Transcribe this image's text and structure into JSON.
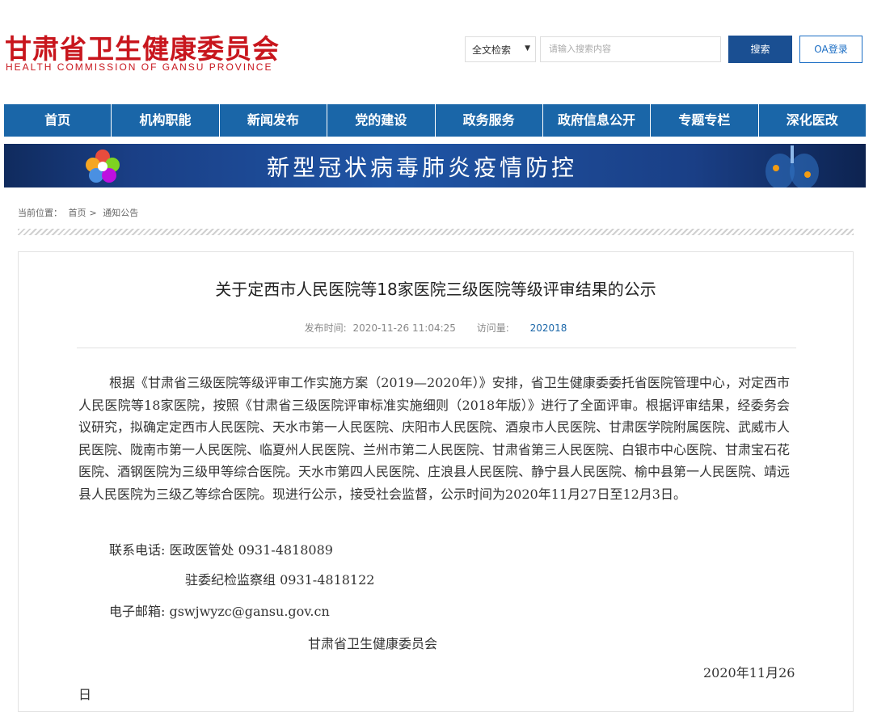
{
  "header": {
    "logo_cn": "甘肃省卫生健康委员会",
    "logo_en": "HEALTH COMMISSION OF GANSU PROVINCE",
    "search": {
      "scope": "全文检索",
      "placeholder": "请输入搜索内容",
      "button": "搜索"
    },
    "oa_button": "OA登录"
  },
  "nav": [
    "首页",
    "机构职能",
    "新闻发布",
    "党的建设",
    "政务服务",
    "政府信息公开",
    "专题专栏",
    "深化医改"
  ],
  "banner": {
    "text": "新型冠状病毒肺炎疫情防控"
  },
  "breadcrumb": {
    "label": "当前位置：",
    "home": "首页",
    "sep": ">",
    "current": "通知公告"
  },
  "article": {
    "title": "关于定西市人民医院等18家医院三级医院等级评审结果的公示",
    "publish_label": "发布时间:",
    "publish_time": "2020-11-26 11:04:25",
    "views_label": "访问量:",
    "views": "202018",
    "body": "根据《甘肃省三级医院等级评审工作实施方案（2019—2020年）》安排，省卫生健康委委托省医院管理中心，对定西市人民医院等18家医院，按照《甘肃省三级医院评审标准实施细则（2018年版）》进行了全面评审。根据评审结果，经委务会议研究，拟确定定西市人民医院、天水市第一人民医院、庆阳市人民医院、酒泉市人民医院、甘肃医学院附属医院、武威市人民医院、陇南市第一人民医院、临夏州人民医院、兰州市第二人民医院、甘肃省第三人民医院、白银市中心医院、甘肃宝石花医院、酒钢医院为三级甲等综合医院。天水市第四人民医院、庄浪县人民医院、静宁县人民医院、榆中县第一人民医院、靖远县人民医院为三级乙等综合医院。现进行公示，接受社会监督，公示时间为2020年11月27日至12月3日。",
    "contact1": "联系电话: 医政医管处 0931-4818089",
    "contact2": "驻委纪检监察组  0931-4818122",
    "email": "电子邮箱: gswjwyzc@gansu.gov.cn",
    "signature": "甘肃省卫生健康委员会",
    "date_part1": "2020年11月26",
    "date_part2": "日"
  }
}
